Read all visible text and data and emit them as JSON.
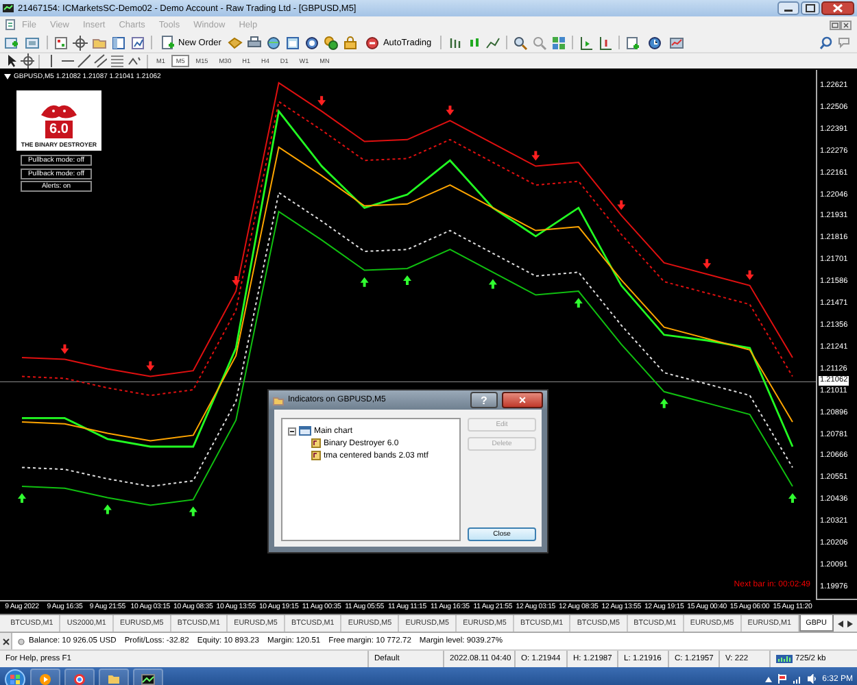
{
  "window": {
    "title": "21467154: ICMarketsSC-Demo02 - Demo Account - Raw Trading Ltd - [GBPUSD,M5]"
  },
  "menu": [
    {
      "label": "File",
      "disabled": true
    },
    {
      "label": "View",
      "disabled": true
    },
    {
      "label": "Insert",
      "disabled": true
    },
    {
      "label": "Charts",
      "disabled": true
    },
    {
      "label": "Tools",
      "disabled": true
    },
    {
      "label": "Window",
      "disabled": true
    },
    {
      "label": "Help",
      "disabled": true
    }
  ],
  "toolbar": {
    "new_order": "New Order",
    "auto_trading": "AutoTrading"
  },
  "timeframes": [
    {
      "label": "M1",
      "selected": false
    },
    {
      "label": "M5",
      "selected": true
    },
    {
      "label": "M15",
      "selected": false
    },
    {
      "label": "M30",
      "selected": false
    },
    {
      "label": "H1",
      "selected": false
    },
    {
      "label": "H4",
      "selected": false
    },
    {
      "label": "D1",
      "selected": false
    },
    {
      "label": "W1",
      "selected": false
    },
    {
      "label": "MN",
      "selected": false
    }
  ],
  "chart": {
    "symbol_info": "GBPUSD,M5  1.21082 1.21087 1.21041 1.21062",
    "logo": {
      "version": "6.0",
      "name": "THE BINARY DESTROYER"
    },
    "panel_buttons": [
      "Pullback mode: off",
      "Pullback mode: off",
      "Alerts: on"
    ],
    "timer": "Next bar in: 00:02:49",
    "current_price": "1.21062",
    "chart_data": {
      "type": "line",
      "categories": [
        "9 Aug 2022",
        "9 Aug 16:35",
        "9 Aug 21:55",
        "10 Aug 03:15",
        "10 Aug 08:35",
        "10 Aug 13:55",
        "10 Aug 19:15",
        "11 Aug 00:35",
        "11 Aug 05:55",
        "11 Aug 11:15",
        "11 Aug 16:35",
        "11 Aug 21:55",
        "12 Aug 03:15",
        "12 Aug 08:35",
        "12 Aug 13:55",
        "12 Aug 19:15",
        "15 Aug 00:40",
        "15 Aug 06:00",
        "15 Aug 11:20"
      ],
      "ylim": [
        1.1991,
        1.22708
      ],
      "ref_lines": [
        {
          "axis": "y",
          "value": 1.21062,
          "color": "#777777"
        }
      ],
      "yticks": [
        1.22621,
        1.22506,
        1.22391,
        1.22276,
        1.22161,
        1.22046,
        1.21931,
        1.21816,
        1.21701,
        1.21586,
        1.21471,
        1.21356,
        1.21241,
        1.21126,
        1.21011,
        1.20896,
        1.20781,
        1.20666,
        1.20551,
        1.20436,
        1.20321,
        1.20206,
        1.20091,
        1.19976
      ],
      "series": [
        {
          "color": "#e01010",
          "values": [
            1.2119,
            1.2118,
            1.2113,
            1.2109,
            1.2112,
            1.2154,
            1.2264,
            1.2249,
            1.2233,
            1.2234,
            1.2244,
            1.2232,
            1.222,
            1.2222,
            1.2194,
            1.2169,
            1.2163,
            1.2157,
            1.2119
          ]
        },
        {
          "color": "#e01010",
          "line_style": "dashed",
          "values": [
            1.2109,
            1.2108,
            1.2103,
            1.2099,
            1.2102,
            1.2144,
            1.2254,
            1.2239,
            1.2223,
            1.2224,
            1.2234,
            1.2222,
            1.221,
            1.2212,
            1.2184,
            1.2159,
            1.2153,
            1.2147,
            1.2109
          ]
        },
        {
          "color": "#e0e0e0",
          "line_style": "dashed",
          "values": [
            1.2061,
            1.206,
            1.2055,
            1.2051,
            1.2054,
            1.2096,
            1.2206,
            1.2191,
            1.2175,
            1.2176,
            1.2186,
            1.2174,
            1.2162,
            1.2164,
            1.2136,
            1.2111,
            1.2105,
            1.2099,
            1.2061
          ]
        },
        {
          "color": "#10c010",
          "values": [
            1.2051,
            1.205,
            1.2045,
            1.2041,
            1.2044,
            1.2086,
            1.2196,
            1.2181,
            1.2165,
            1.2166,
            1.2176,
            1.2164,
            1.2152,
            1.2154,
            1.2126,
            1.2101,
            1.2095,
            1.2089,
            1.2051
          ]
        },
        {
          "color": "#22ff22",
          "values": [
            1.2087,
            1.2087,
            1.2076,
            1.2072,
            1.2072,
            1.2124,
            1.2249,
            1.222,
            1.2198,
            1.2205,
            1.2223,
            1.2198,
            1.2183,
            1.2198,
            1.2157,
            1.2131,
            1.2128,
            1.2124,
            1.2072
          ]
        },
        {
          "color": "#ffa500",
          "values": [
            1.2085,
            1.2084,
            1.2079,
            1.2075,
            1.2078,
            1.212,
            1.223,
            1.2215,
            1.2199,
            1.22,
            1.221,
            1.2198,
            1.2186,
            1.2188,
            1.216,
            1.2135,
            1.2129,
            1.2123,
            1.2085
          ]
        }
      ]
    }
  },
  "dialog": {
    "title": "Indicators on GBPUSD,M5",
    "help_button": "?",
    "close_button": "×",
    "tree": [
      {
        "label": "Main chart",
        "expanded": true,
        "children": [
          {
            "label": "Binary Destroyer 6.0"
          },
          {
            "label": "tma centered bands 2.03 mtf"
          }
        ]
      }
    ],
    "buttons": [
      {
        "label": "Edit",
        "disabled": true
      },
      {
        "label": "Delete",
        "disabled": true
      },
      {
        "label": "Close",
        "disabled": false
      }
    ]
  },
  "chart_tabs": [
    {
      "label": "BTCUSD,M1",
      "selected": false
    },
    {
      "label": "US2000,M1",
      "selected": false
    },
    {
      "label": "EURUSD,M5",
      "selected": false
    },
    {
      "label": "BTCUSD,M1",
      "selected": false
    },
    {
      "label": "EURUSD,M5",
      "selected": false
    },
    {
      "label": "BTCUSD,M1",
      "selected": false
    },
    {
      "label": "EURUSD,M5",
      "selected": false
    },
    {
      "label": "EURUSD,M5",
      "selected": false
    },
    {
      "label": "EURUSD,M5",
      "selected": false
    },
    {
      "label": "BTCUSD,M1",
      "selected": false
    },
    {
      "label": "BTCUSD,M5",
      "selected": false
    },
    {
      "label": "BTCUSD,M1",
      "selected": false
    },
    {
      "label": "EURUSD,M5",
      "selected": false
    },
    {
      "label": "EURUSD,M1",
      "selected": false
    },
    {
      "label": "GBPU",
      "selected": true
    }
  ],
  "account": [
    "Balance: 10 926.05 USD",
    "Profit/Loss: -32.82",
    "Equity: 10 893.23",
    "Margin: 120.51",
    "Free margin: 10 772.72",
    "Margin level: 9039.27%"
  ],
  "status_bar": [
    "For Help, press F1",
    "Default",
    "2022.08.11 04:40",
    "O: 1.21944",
    "H: 1.21987",
    "L: 1.21916",
    "C: 1.21957",
    "V: 222",
    "725/2 kb"
  ],
  "taskbar": {
    "clock": "6:32 PM"
  }
}
